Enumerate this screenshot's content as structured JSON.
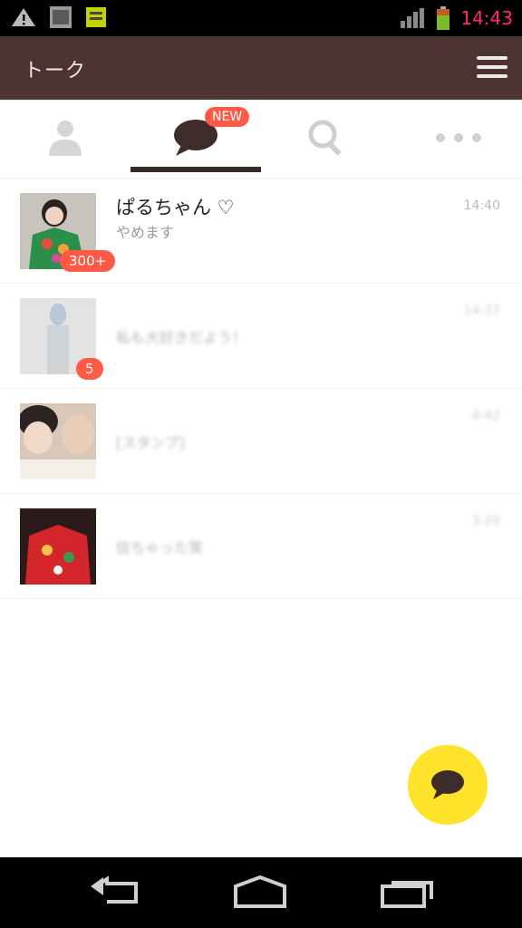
{
  "status_bar": {
    "time": "14:43",
    "icons": [
      "warning-icon",
      "image-icon",
      "download-icon",
      "battery-icon",
      "signal-icon"
    ]
  },
  "app_bar": {
    "title": "トーク",
    "menu_icon": "menu-icon"
  },
  "tabs": [
    {
      "name": "friends",
      "icon": "person-icon"
    },
    {
      "name": "chats",
      "icon": "chat-bubble-icon",
      "badge": "NEW",
      "active": true
    },
    {
      "name": "search",
      "icon": "search-icon"
    },
    {
      "name": "more",
      "icon": "more-icon"
    }
  ],
  "chats": [
    {
      "name": "ぱるちゃん ♡",
      "preview": "やめます",
      "time": "14:40",
      "unread": "300+"
    },
    {
      "name": "",
      "preview": "私も大好きだよう！",
      "time": "14:37",
      "unread": "5"
    },
    {
      "name": "",
      "preview": "[スタンプ]",
      "time": "4:42",
      "unread": ""
    },
    {
      "name": "",
      "preview": "信ちゃった笑",
      "time": "3:20",
      "unread": ""
    }
  ],
  "fab": {
    "icon": "new-chat-icon"
  },
  "nav_bar": {
    "back": "back-icon",
    "home": "home-icon",
    "recents": "recent-apps-icon"
  },
  "colors": {
    "app_bar": "#4d3432",
    "badge": "#ff5a46",
    "fab": "#ffe32a",
    "clock": "#ff2a6a"
  }
}
